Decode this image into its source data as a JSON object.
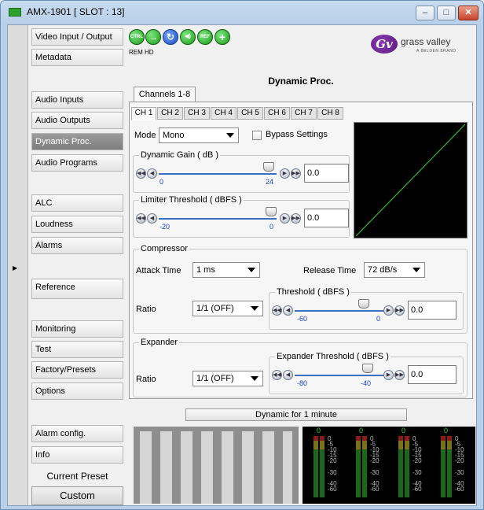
{
  "window": {
    "title": "AMX-1901 [ SLOT : 13]",
    "min_label": "–",
    "max_label": "□",
    "close_label": "✕"
  },
  "sidebar": {
    "items": [
      {
        "label": "Video Input / Output"
      },
      {
        "label": "Metadata"
      },
      {
        "label": "Audio Inputs"
      },
      {
        "label": "Audio Outputs"
      },
      {
        "label": "Dynamic Proc."
      },
      {
        "label": "Audio Programs"
      },
      {
        "label": "ALC"
      },
      {
        "label": "Loudness"
      },
      {
        "label": "Alarms"
      },
      {
        "label": "Reference"
      },
      {
        "label": "Monitoring"
      },
      {
        "label": "Test"
      },
      {
        "label": "Factory/Presets"
      },
      {
        "label": "Options"
      },
      {
        "label": "Alarm config."
      },
      {
        "label": "Info"
      }
    ],
    "active": "Dynamic Proc.",
    "current_preset_label": "Current Preset",
    "current_preset_value": "Custom"
  },
  "toolbar": {
    "icons": [
      {
        "name": "ctrl-status-icon",
        "glyph": "CTRL"
      },
      {
        "name": "arrow-right-icon",
        "glyph": "→"
      },
      {
        "name": "refresh-icon",
        "glyph": "↻"
      },
      {
        "name": "speaker-icon",
        "glyph": "◀)"
      },
      {
        "name": "ref-icon",
        "glyph": "REF"
      },
      {
        "name": "plus-icon",
        "glyph": "+"
      }
    ],
    "rem_label": "REM",
    "hd_label": "HD"
  },
  "logo": {
    "mark": "Gv",
    "text": "grass valley",
    "sub": "A BELDEN BRAND"
  },
  "page": {
    "heading": "Dynamic Proc.",
    "group_tab": "Channels 1-8",
    "channel_tabs": [
      "CH 1",
      "CH 2",
      "CH 3",
      "CH 4",
      "CH 5",
      "CH 6",
      "CH 7",
      "CH 8"
    ],
    "active_channel": "CH 1"
  },
  "mode": {
    "label": "Mode",
    "value": "Mono",
    "bypass_label": "Bypass Settings",
    "bypass_checked": false
  },
  "dynamic_gain": {
    "title": "Dynamic Gain ( dB )",
    "min": "0",
    "current": "24",
    "input": "0.0"
  },
  "limiter": {
    "title": "Limiter Threshold ( dBFS )",
    "min": "-20",
    "current": "0",
    "input": "0.0"
  },
  "compressor": {
    "title": "Compressor",
    "attack_label": "Attack Time",
    "attack_value": "1 ms",
    "release_label": "Release Time",
    "release_value": "72 dB/s",
    "ratio_label": "Ratio",
    "ratio_value": "1/1 (OFF)",
    "threshold_title": "Threshold ( dBFS )",
    "threshold_min": "-60",
    "threshold_current": "0",
    "threshold_input": "0.0"
  },
  "expander": {
    "title": "Expander",
    "ratio_label": "Ratio",
    "ratio_value": "1/1 (OFF)",
    "threshold_title": "Expander Threshold ( dBFS )",
    "threshold_min": "-80",
    "threshold_current": "-40",
    "threshold_input": "0.0"
  },
  "status": {
    "text": "Dynamic for 1 minute"
  },
  "meters": {
    "zero": "0",
    "scale": [
      "0",
      "-5",
      "-10",
      "-15",
      "-20",
      "-30",
      "-40",
      "-60"
    ]
  },
  "colors": {
    "accent": "#1a3fd0",
    "graph_line": "#2fbf2f",
    "status_green": "#1c9a1c"
  }
}
